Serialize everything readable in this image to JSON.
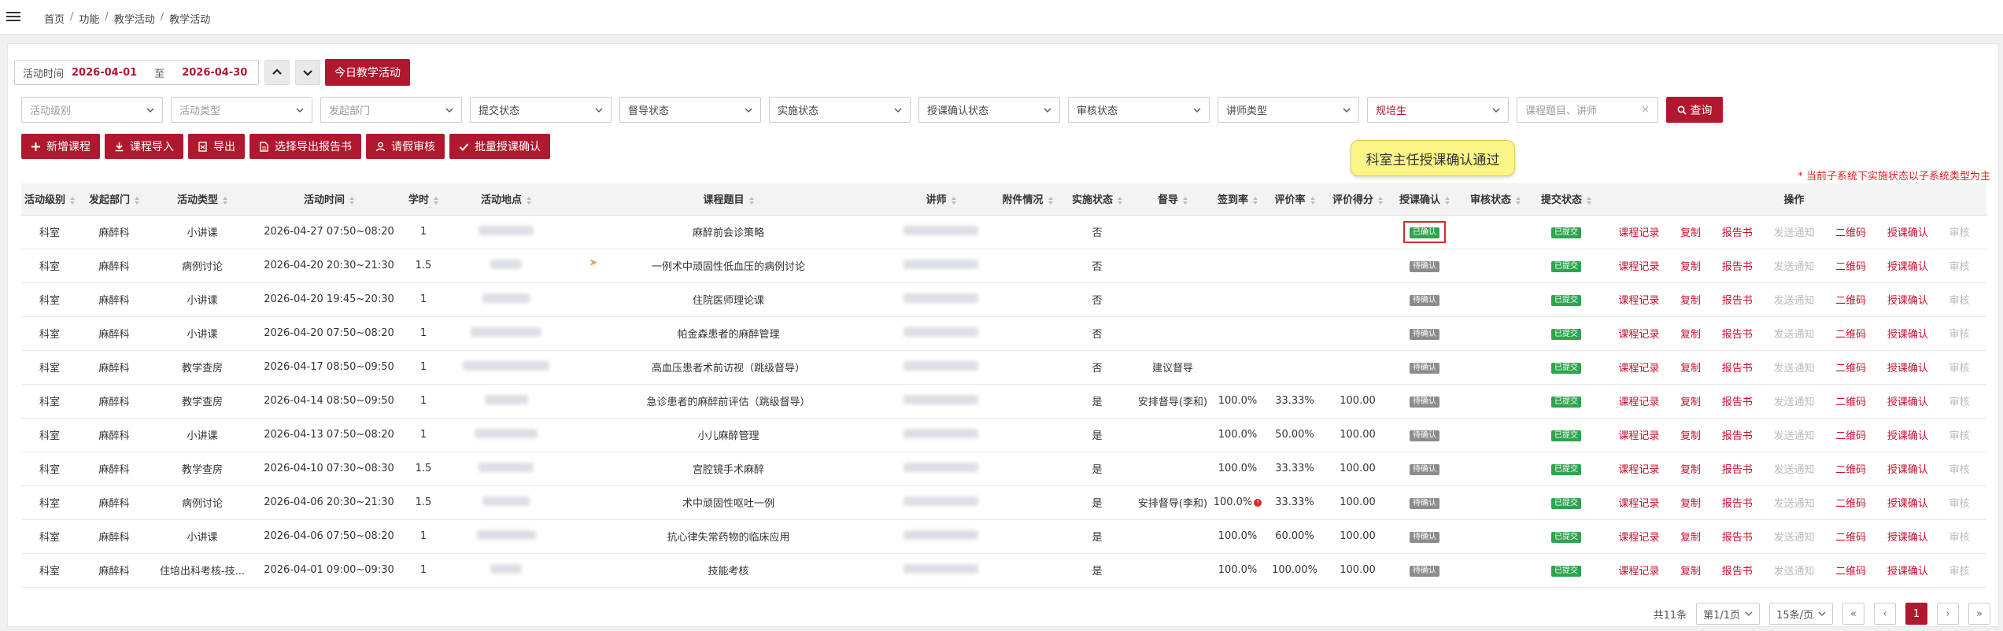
{
  "breadcrumb": [
    "首页",
    "功能",
    "教学活动",
    "教学活动"
  ],
  "date_filter": {
    "label": "活动时间",
    "start": "2026-04-01",
    "to": "至",
    "end": "2026-04-30"
  },
  "today_button": "今日教学活动",
  "filters": [
    {
      "placeholder": "活动级别",
      "style": "muted"
    },
    {
      "placeholder": "活动类型",
      "style": "muted"
    },
    {
      "placeholder": "发起部门",
      "style": "muted"
    },
    {
      "placeholder": "提交状态",
      "style": "dark"
    },
    {
      "placeholder": "督导状态",
      "style": "dark"
    },
    {
      "placeholder": "实施状态",
      "style": "dark"
    },
    {
      "placeholder": "授课确认状态",
      "style": "dark"
    },
    {
      "placeholder": "审核状态",
      "style": "dark"
    },
    {
      "placeholder": "讲师类型",
      "style": "dark"
    },
    {
      "placeholder": "规培生",
      "style": "red"
    }
  ],
  "search_placeholder": "课程题目、讲师",
  "query_button": "查询",
  "actions": [
    {
      "label": "新增课程",
      "icon": "plus-icon"
    },
    {
      "label": "课程导入",
      "icon": "download-icon"
    },
    {
      "label": "导出",
      "icon": "file-export-icon"
    },
    {
      "label": "选择导出报告书",
      "icon": "file-icon"
    },
    {
      "label": "请假审核",
      "icon": "user-icon"
    },
    {
      "label": "批量授课确认",
      "icon": "check-icon"
    }
  ],
  "tooltip": "科室主任授课确认通过",
  "note": "* 当前子系统下实施状态以子系统类型为主",
  "columns": [
    "活动级别",
    "发起部门",
    "活动类型",
    "活动时间",
    "学时",
    "活动地点",
    "课程题目",
    "讲师",
    "附件情况",
    "实施状态",
    "督导",
    "签到率",
    "评价率",
    "评价得分",
    "授课确认",
    "审核状态",
    "提交状态",
    "操作"
  ],
  "rows": [
    {
      "level": "科室",
      "dept": "麻醉科",
      "type": "小讲课",
      "time": "2026-04-27  07:50~08:20",
      "hours": "1",
      "topic": "麻醉前会诊策略",
      "impl": "否",
      "supervise": "",
      "sign": "",
      "eval_rate": "",
      "score": "",
      "confirm": "已确认",
      "confirm_state": "done",
      "submit": "已提交"
    },
    {
      "level": "科室",
      "dept": "麻醉科",
      "type": "病例讨论",
      "time": "2026-04-20  20:30~21:30",
      "hours": "1.5",
      "topic": "一例术中顽固性低血压的病例讨论",
      "impl": "否",
      "supervise": "",
      "sign": "",
      "eval_rate": "",
      "score": "",
      "confirm": "待确认",
      "confirm_state": "pending",
      "submit": "已提交"
    },
    {
      "level": "科室",
      "dept": "麻醉科",
      "type": "小讲课",
      "time": "2026-04-20  19:45~20:30",
      "hours": "1",
      "topic": "住院医师理论课",
      "impl": "否",
      "supervise": "",
      "sign": "",
      "eval_rate": "",
      "score": "",
      "confirm": "待确认",
      "confirm_state": "pending",
      "submit": "已提交"
    },
    {
      "level": "科室",
      "dept": "麻醉科",
      "type": "小讲课",
      "time": "2026-04-20  07:50~08:20",
      "hours": "1",
      "topic": "帕金森患者的麻醉管理",
      "impl": "否",
      "supervise": "",
      "sign": "",
      "eval_rate": "",
      "score": "",
      "confirm": "待确认",
      "confirm_state": "pending",
      "submit": "已提交"
    },
    {
      "level": "科室",
      "dept": "麻醉科",
      "type": "教学查房",
      "time": "2026-04-17  08:50~09:50",
      "hours": "1",
      "topic": "高血压患者术前访视（跳级督导）",
      "impl": "否",
      "supervise": "建议督导",
      "sign": "",
      "eval_rate": "",
      "score": "",
      "confirm": "待确认",
      "confirm_state": "pending",
      "submit": "已提交"
    },
    {
      "level": "科室",
      "dept": "麻醉科",
      "type": "教学查房",
      "time": "2026-04-14  08:50~09:50",
      "hours": "1",
      "topic": "急诊患者的麻醉前评估（跳级督导）",
      "impl": "是",
      "supervise": "安排督导(李和)",
      "sign": "100.0%",
      "eval_rate": "33.33%",
      "score": "100.00",
      "confirm": "待确认",
      "confirm_state": "pending",
      "submit": "已提交"
    },
    {
      "level": "科室",
      "dept": "麻醉科",
      "type": "小讲课",
      "time": "2026-04-13  07:50~08:20",
      "hours": "1",
      "topic": "小儿麻醉管理",
      "impl": "是",
      "supervise": "",
      "sign": "100.0%",
      "eval_rate": "50.00%",
      "score": "100.00",
      "confirm": "待确认",
      "confirm_state": "pending",
      "submit": "已提交"
    },
    {
      "level": "科室",
      "dept": "麻醉科",
      "type": "教学查房",
      "time": "2026-04-10  07:30~08:30",
      "hours": "1.5",
      "topic": "宫腔镜手术麻醉",
      "impl": "是",
      "supervise": "",
      "sign": "100.0%",
      "eval_rate": "33.33%",
      "score": "100.00",
      "confirm": "待确认",
      "confirm_state": "pending",
      "submit": "已提交"
    },
    {
      "level": "科室",
      "dept": "麻醉科",
      "type": "病例讨论",
      "time": "2026-04-06  20:30~21:30",
      "hours": "1.5",
      "topic": "术中顽固性呕吐一例",
      "impl": "是",
      "supervise": "安排督导(李和)",
      "sign": "100.0%",
      "eval_rate": "33.33%",
      "score": "100.00",
      "confirm": "待确认",
      "confirm_state": "pending",
      "submit": "已提交",
      "sign_info": true
    },
    {
      "level": "科室",
      "dept": "麻醉科",
      "type": "小讲课",
      "time": "2026-04-06  07:50~08:20",
      "hours": "1",
      "topic": "抗心律失常药物的临床应用",
      "impl": "是",
      "supervise": "",
      "sign": "100.0%",
      "eval_rate": "60.00%",
      "score": "100.00",
      "confirm": "待确认",
      "confirm_state": "pending",
      "submit": "已提交"
    },
    {
      "level": "科室",
      "dept": "麻醉科",
      "type": "住培出科考核-技...",
      "time": "2026-04-01  09:00~09:30",
      "hours": "1",
      "topic": "技能考核",
      "impl": "是",
      "supervise": "",
      "sign": "100.0%",
      "eval_rate": "100.00%",
      "score": "100.00",
      "confirm": "待确认",
      "confirm_state": "pending",
      "submit": "已提交"
    }
  ],
  "row_ops": [
    "课程记录",
    "复制",
    "报告书",
    "发送通知",
    "二维码",
    "授课确认",
    "审核"
  ],
  "row_ops_muted": [
    "发送通知",
    "审核"
  ],
  "pager": {
    "total": "共11条",
    "page_select": "第1/1页",
    "size_select": "15条/页",
    "first": "«",
    "prev": "‹",
    "current": "1",
    "next": "›",
    "last": "»"
  },
  "colors": {
    "primary": "#b0182f",
    "link": "#c8102e",
    "success": "#2ea44f",
    "pending": "#8c8c8c",
    "tooltip_bg": "#fbf587"
  }
}
